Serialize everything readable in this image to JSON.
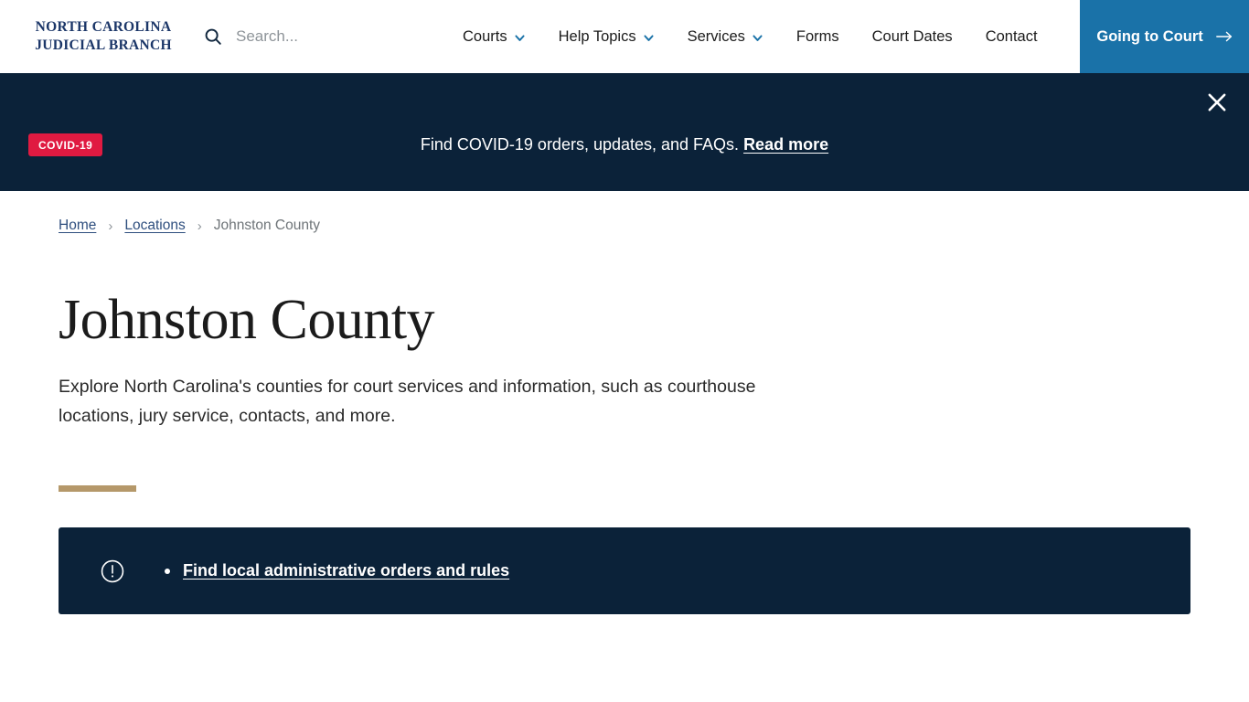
{
  "header": {
    "logo": {
      "line1": "NORTH CAROLINA",
      "line2": "JUDICIAL BRANCH"
    },
    "search": {
      "placeholder": "Search...",
      "value": ""
    },
    "nav": [
      {
        "label": "Courts",
        "has_dropdown": true
      },
      {
        "label": "Help Topics",
        "has_dropdown": true
      },
      {
        "label": "Services",
        "has_dropdown": true
      },
      {
        "label": "Forms",
        "has_dropdown": false
      },
      {
        "label": "Court Dates",
        "has_dropdown": false
      },
      {
        "label": "Contact",
        "has_dropdown": false
      }
    ],
    "cta": {
      "label": "Going to Court"
    }
  },
  "banner": {
    "badge": "COVID-19",
    "message": "Find COVID-19 orders, updates, and FAQs. ",
    "link": "Read more",
    "close_icon": "close-icon"
  },
  "breadcrumb": {
    "items": [
      {
        "label": "Home",
        "current": false
      },
      {
        "label": "Locations",
        "current": false
      },
      {
        "label": "Johnston County",
        "current": true
      }
    ],
    "separator": "›"
  },
  "main": {
    "title": "Johnston County",
    "intro": "Explore North Carolina's counties for court services and information, such as courthouse locations, jury service, contacts, and more.",
    "callout": {
      "icon": "exclamation-circle-icon",
      "items": [
        {
          "label": "Find local administrative orders and rules"
        }
      ]
    }
  },
  "colors": {
    "navy": "#0b2239",
    "brand_blue": "#1a72a8",
    "logo_navy": "#1b3668",
    "covid_red": "#e01a41",
    "gold": "#b5986a",
    "link_navy": "#2e4e7e"
  }
}
